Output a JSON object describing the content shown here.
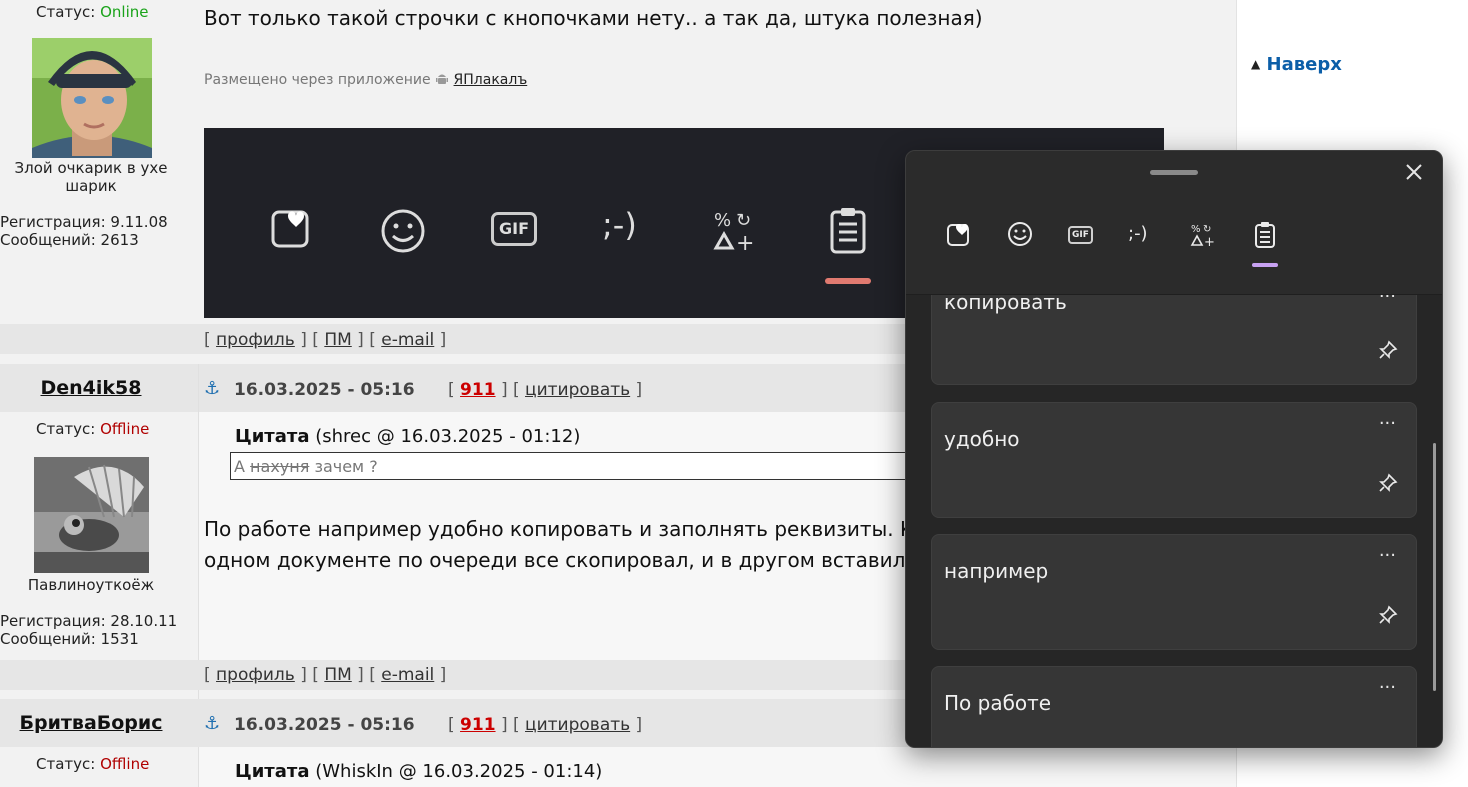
{
  "sidebar": {
    "top_link": "Наверх"
  },
  "post1": {
    "status_label": "Статус:",
    "status": "Online",
    "nick": "Злой очкарик в ухе шарик",
    "reg": "Регистрация: 9.11.08",
    "msgs": "Сообщений: 2613",
    "text": "Вот только такой строчки с кнопочками нету.. а так да, штука полезная)",
    "posted_via": "Размещено через приложение",
    "app_name": "ЯПлакалъ",
    "footer": {
      "profile": "профиль",
      "pm": "ПМ",
      "email": "e-mail"
    }
  },
  "post2": {
    "author": "Den4ik58",
    "date": "16.03.2025 - 05:16",
    "post_no": "911",
    "quote_link": "цитировать",
    "status_label": "Статус:",
    "status": "Offline",
    "nick": "Павлиноуткоёж",
    "reg": "Регистрация: 28.10.11",
    "msgs": "Сообщений: 1531",
    "quote_label": "Цитата",
    "quote_meta": "(shrec @ 16.03.2025 - 01:12)",
    "quote_pre": "А",
    "quote_struck": "нахуня",
    "quote_post": "зачем ?",
    "line1": "По работе например удобно копировать и заполнять реквизиты. Кто",
    "line2": "одном документе по очереди все скопировал, и в другом вставил. О",
    "footer": {
      "profile": "профиль",
      "pm": "ПМ",
      "email": "e-mail"
    }
  },
  "post3": {
    "author": "БритваБорис",
    "date": "16.03.2025 - 05:16",
    "post_no": "911",
    "quote_link": "цитировать",
    "status_label": "Статус:",
    "status": "Offline",
    "quote_label": "Цитата",
    "quote_meta": "(WhiskIn @ 16.03.2025 - 01:14)"
  },
  "strip": {
    "gif": "GIF",
    "emoticon": ";-)"
  },
  "clipboard": {
    "tabs": {
      "gif": "GIF",
      "kaomoji": ";-)"
    },
    "items": [
      {
        "text": "копировать"
      },
      {
        "text": "удобно"
      },
      {
        "text": "например"
      },
      {
        "text": "По работе"
      }
    ],
    "more": "···"
  },
  "colors": {
    "online": "#1aa31a",
    "offline": "#b00000",
    "link_blue": "#0b5ea8",
    "accent_purple": "#c8a2f2"
  }
}
